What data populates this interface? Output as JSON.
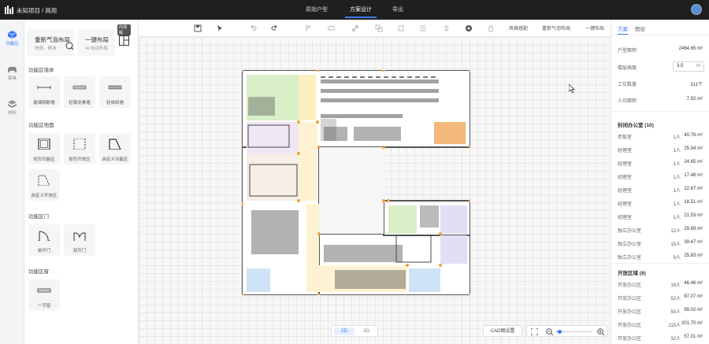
{
  "topbar": {
    "project_title": "未知项目 / 商用",
    "nav": [
      {
        "label": "原始户型",
        "active": false
      },
      {
        "label": "方案设计",
        "active": true
      },
      {
        "label": "导出",
        "active": false
      }
    ]
  },
  "leftnav": [
    {
      "label": "功能区",
      "active": true,
      "icon": "cube-icon"
    },
    {
      "label": "家具",
      "active": false,
      "icon": "sofa-icon"
    },
    {
      "label": "材料",
      "active": false,
      "icon": "material-icon"
    }
  ],
  "panel": {
    "regen": {
      "title": "重新气泡布局",
      "sub": "快速、精准"
    },
    "onekey": {
      "title": "一键布局",
      "sub": "AI 自动布局"
    },
    "badge": "内测版",
    "sections": [
      {
        "title": "功能区墙体",
        "items": [
          "玻璃隔断墙",
          "轻钢龙骨墙",
          "轻体砖墙"
        ]
      },
      {
        "title": "功能区地面",
        "items": [
          "矩形功能区",
          "矩形开放区",
          "自定义功能区",
          "自定义开放区"
        ]
      },
      {
        "title": "功能区门",
        "items": [
          "单开门",
          "双开门"
        ]
      },
      {
        "title": "功能区窗",
        "items": [
          "一字窗"
        ]
      }
    ]
  },
  "toolbar": {
    "labels": [
      "风格搭配",
      "重新气泡布局",
      "一键布局"
    ]
  },
  "canvas": {
    "view_toggle": [
      {
        "label": "2D",
        "active": true
      },
      {
        "label": "3D",
        "active": false
      }
    ],
    "cad_button": "CAD图设置",
    "zoom_level": 0.1
  },
  "right": {
    "tabs": [
      {
        "label": "方案",
        "active": true
      },
      {
        "label": "图层",
        "active": false
      }
    ],
    "props": [
      {
        "label": "户型面积",
        "value": "2464.65 m²"
      },
      {
        "label": "楼层高度",
        "value": "3.5",
        "unit": "m"
      },
      {
        "label": "工位数量",
        "value": "311个"
      },
      {
        "label": "人均面积",
        "value": "7.92 m²"
      }
    ],
    "groups": [
      {
        "title": "封闭办公室 (10)",
        "rows": [
          {
            "name": "老板室",
            "people": "1人",
            "area": "40.76 m²"
          },
          {
            "name": "经理室",
            "people": "1人",
            "area": "25.54 m²"
          },
          {
            "name": "经理室",
            "people": "1人",
            "area": "24.65 m²"
          },
          {
            "name": "经理室",
            "people": "1人",
            "area": "17.46 m²"
          },
          {
            "name": "经理室",
            "people": "1人",
            "area": "22.67 m²"
          },
          {
            "name": "经理室",
            "people": "1人",
            "area": "18.51 m²"
          },
          {
            "name": "经理室",
            "people": "1人",
            "area": "21.53 m²"
          },
          {
            "name": "独立办公室",
            "people": "12人",
            "area": "29.89 m²"
          },
          {
            "name": "独立办公室",
            "people": "15人",
            "area": "39.47 m²"
          },
          {
            "name": "独立办公室",
            "people": "9人",
            "area": "25.83 m²"
          }
        ]
      },
      {
        "title": "开放区域 (8)",
        "rows": [
          {
            "name": "开放办公区",
            "people": "19人",
            "area": "46.46 m²"
          },
          {
            "name": "开放办公区",
            "people": "52人",
            "area": "97.07 m²"
          },
          {
            "name": "开放办公区",
            "people": "50人",
            "area": "99.02 m²"
          },
          {
            "name": "开放办公区",
            "people": "115人",
            "area": "201.70 m²"
          },
          {
            "name": "开放办公区",
            "people": "32人",
            "area": "57.01 m²"
          }
        ]
      }
    ]
  }
}
